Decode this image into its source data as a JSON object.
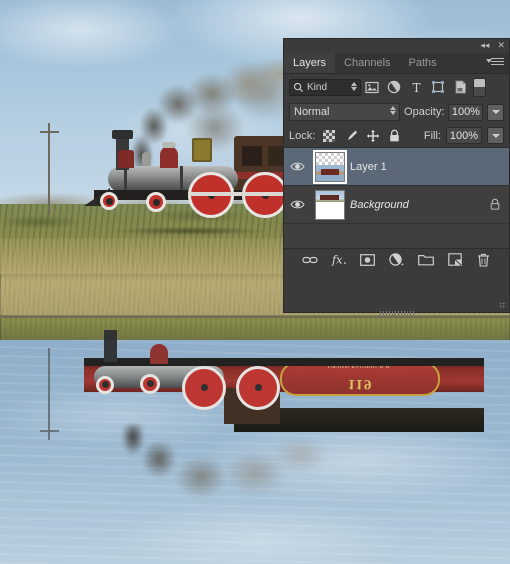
{
  "document": {
    "image_description": "Steam locomotive photograph with mirrored water reflection",
    "subject": "vintage steam locomotive",
    "reflection_number": "119",
    "reflection_roadname": "UNION PACIFIC R.R."
  },
  "panel": {
    "titlebar": {
      "collapse_label": "◂◂",
      "close_label": "✕"
    },
    "tabs": [
      {
        "label": "Layers",
        "active": true
      },
      {
        "label": "Channels",
        "active": false
      },
      {
        "label": "Paths",
        "active": false
      }
    ],
    "filter": {
      "kind_label": "Kind",
      "search_icon": "search-icon",
      "buttons": [
        "filter-pixel-layers-icon",
        "filter-adjustment-layers-icon",
        "filter-type-layers-icon",
        "filter-shape-layers-icon",
        "filter-smart-object-layers-icon"
      ],
      "toggle": "filter-enable-toggle"
    },
    "blend": {
      "mode": "Normal",
      "opacity_label": "Opacity:",
      "opacity_value": "100%"
    },
    "lock": {
      "label": "Lock:",
      "buttons": [
        "lock-transparent-pixels-icon",
        "lock-image-pixels-icon",
        "lock-position-icon",
        "lock-all-icon"
      ],
      "fill_label": "Fill:",
      "fill_value": "100%"
    },
    "layers": [
      {
        "name": "Layer 1",
        "visible": true,
        "selected": true,
        "locked": false,
        "italic": false,
        "thumb": "transparent-over-reflection"
      },
      {
        "name": "Background",
        "visible": true,
        "selected": false,
        "locked": true,
        "italic": true,
        "thumb": "photo-over-white"
      }
    ],
    "bottom_buttons": [
      "link-layers-icon",
      "layer-style-fx-icon",
      "add-layer-mask-icon",
      "new-adjustment-layer-icon",
      "new-group-icon",
      "new-layer-icon",
      "delete-layer-icon"
    ]
  },
  "colors": {
    "panel_bg": "#3b3b3b",
    "list_bg": "#3f3f3f",
    "selection": "#5a6878",
    "text": "#c8c8c8",
    "accent_red": "#c0312b",
    "gold": "#caa13a"
  }
}
